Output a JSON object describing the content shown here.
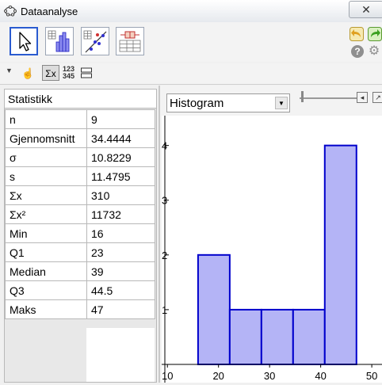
{
  "window": {
    "title": "Dataanalyse"
  },
  "statistics": {
    "header": "Statistikk",
    "rows": [
      {
        "label": "n",
        "value": "9"
      },
      {
        "label": "Gjennomsnitt",
        "value": "34.4444"
      },
      {
        "label": "σ",
        "value": "10.8229"
      },
      {
        "label": "s",
        "value": "11.4795"
      },
      {
        "label": "Σx",
        "value": "310"
      },
      {
        "label": "Σx²",
        "value": "11732"
      },
      {
        "label": "Min",
        "value": "16"
      },
      {
        "label": "Q1",
        "value": "23"
      },
      {
        "label": "Median",
        "value": "39"
      },
      {
        "label": "Q3",
        "value": "44.5"
      },
      {
        "label": "Maks",
        "value": "47"
      }
    ]
  },
  "subbar": {
    "number_icon_top": "123",
    "number_icon_bottom": "345"
  },
  "plot_type": {
    "selected": "Histogram"
  },
  "chart_data": {
    "type": "bar",
    "bins": [
      {
        "from": 16,
        "to": 22.2,
        "value": 2
      },
      {
        "from": 22.2,
        "to": 28.4,
        "value": 1
      },
      {
        "from": 28.4,
        "to": 34.6,
        "value": 1
      },
      {
        "from": 34.6,
        "to": 40.8,
        "value": 1
      },
      {
        "from": 40.8,
        "to": 47,
        "value": 4
      }
    ],
    "x_ticks": [
      10,
      20,
      30,
      40,
      50
    ],
    "y_ticks": [
      1,
      2,
      3,
      4
    ],
    "xlim": [
      9.5,
      52
    ],
    "ylim": [
      0,
      4.4
    ],
    "bar_color": "#b4b4f6",
    "bar_edge_color": "#0000cc"
  }
}
